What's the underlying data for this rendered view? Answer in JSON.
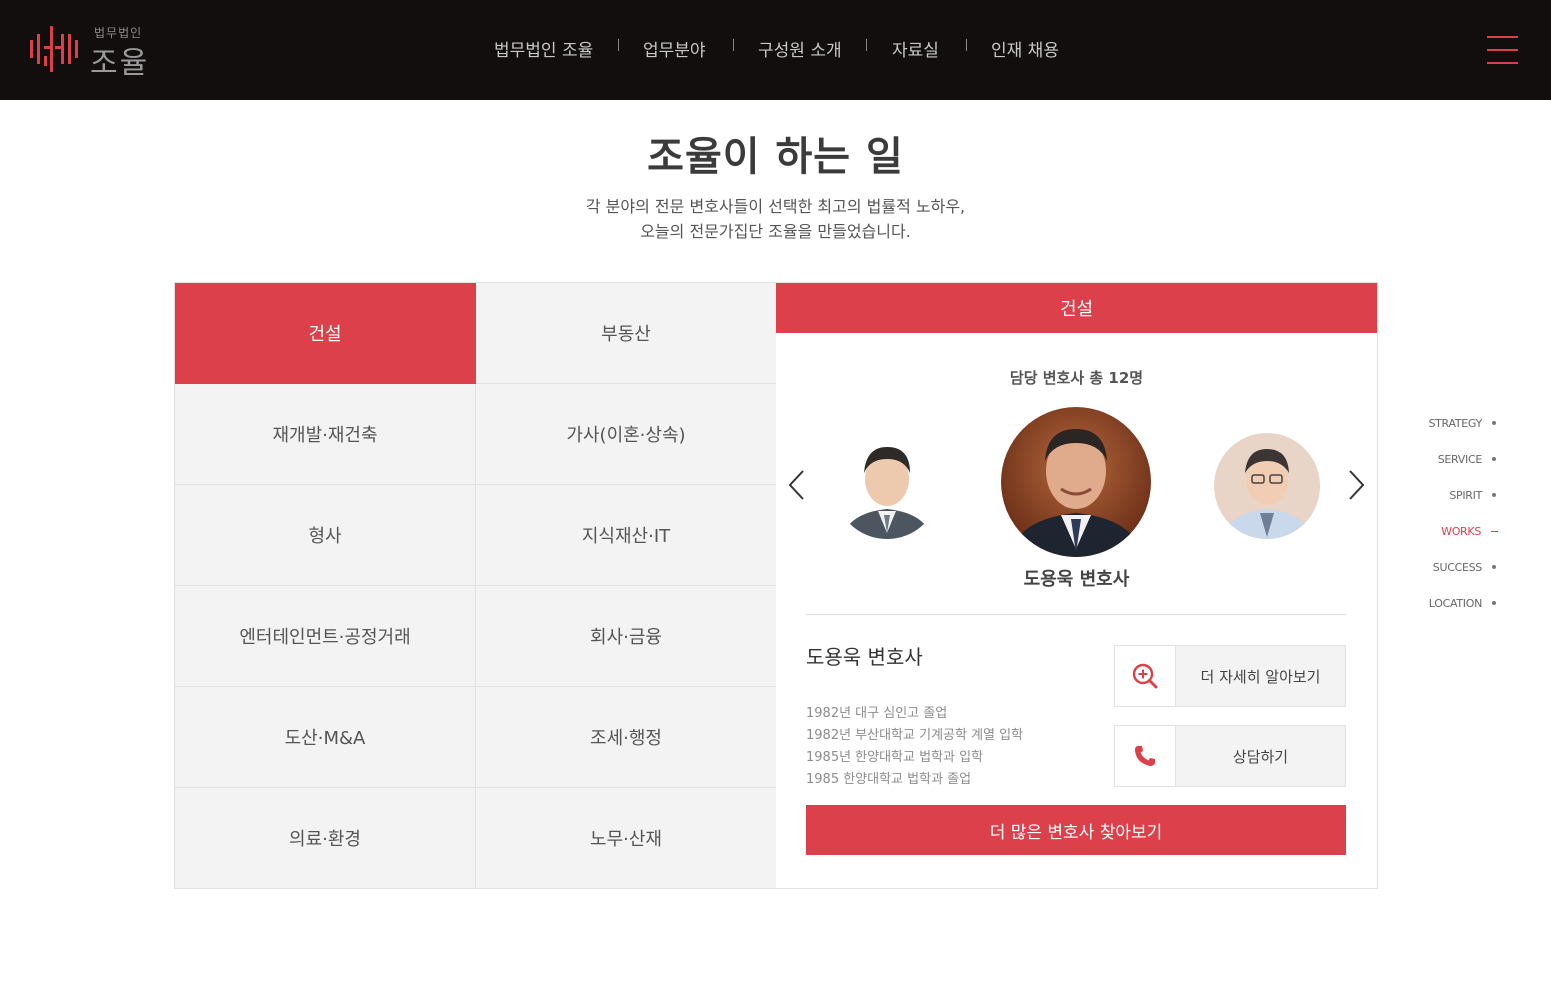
{
  "header": {
    "logo_small": "법무법인",
    "logo_big": "조율",
    "nav": [
      "법무법인 조율",
      "업무분야",
      "구성원 소개",
      "자료실",
      "인재 채용"
    ],
    "accent_color": "#dc404b"
  },
  "intro": {
    "title": "조율이 하는 일",
    "subtitle_line1": "각 분야의 전문 변호사들이 선택한 최고의 법률적 노하우,",
    "subtitle_line2": "오늘의 전문가집단 조율을 만들었습니다."
  },
  "categories": [
    "건설",
    "부동산",
    "재개발·재건축",
    "가사(이혼·상속)",
    "형사",
    "지식재산·IT",
    "엔터테인먼트·공정거래",
    "회사·금융",
    "도산·M&A",
    "조세·행정",
    "의료·환경",
    "노무·산재"
  ],
  "selected_category": "건설",
  "panel": {
    "title": "건설",
    "count_text": "담당 변호사 총 12명",
    "featured_caption": "도용욱 변호사",
    "lawyer_name": "도용욱 변호사",
    "career": [
      "1982년 대구 심인고 졸업",
      "1982년 부산대학교 기계공학 계열 입학",
      "1985년 한양대학교 법학과 입학",
      "1985 한양대학교 법학과 졸업"
    ],
    "detail_button": "더 자세히 알아보기",
    "detail_icon": "zoom-in-icon",
    "consult_button": "상담하기",
    "consult_icon": "phone-icon",
    "more_button": "더 많은 변호사 찾아보기"
  },
  "side_nav": {
    "items": [
      "STRATEGY",
      "SERVICE",
      "SPIRIT",
      "WORKS",
      "SUCCESS",
      "LOCATION"
    ],
    "active": "WORKS"
  }
}
